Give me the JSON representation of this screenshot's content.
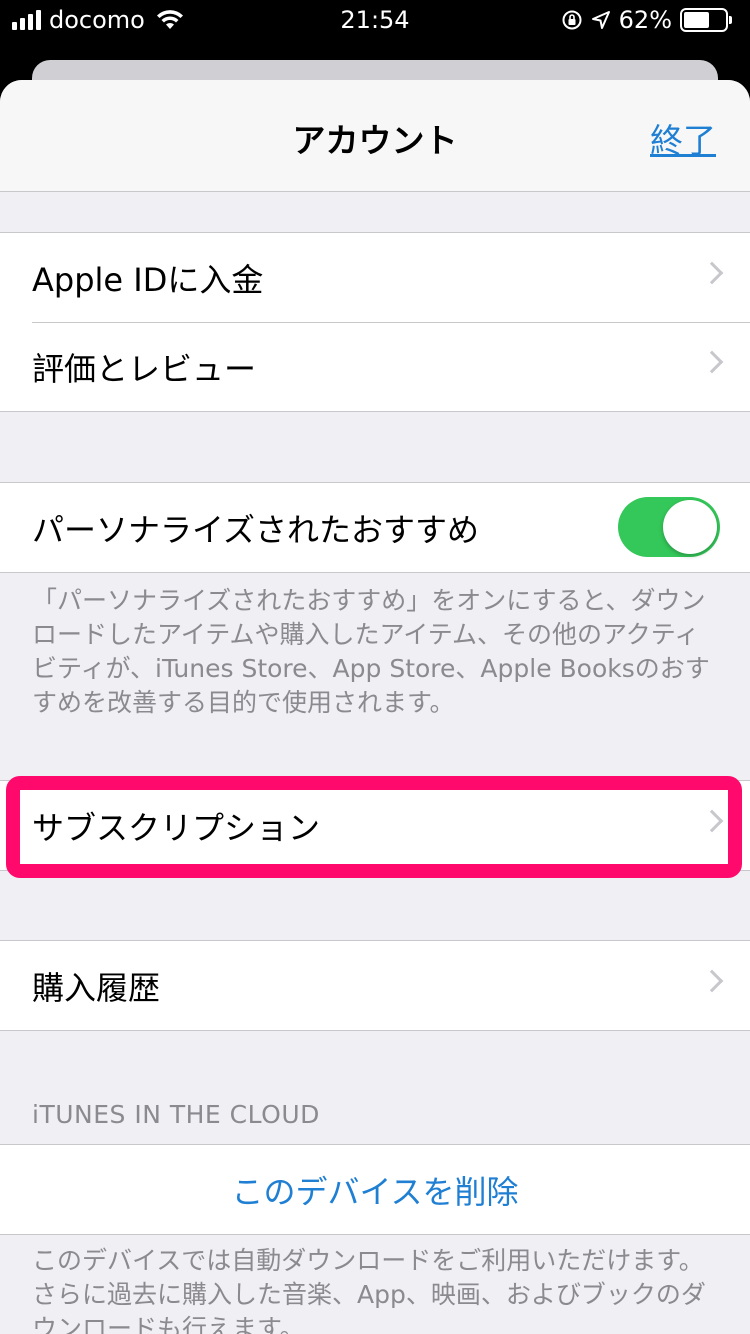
{
  "status_bar": {
    "carrier": "docomo",
    "time": "21:54",
    "battery_percent": "62%",
    "battery_level": 0.62,
    "icons": [
      "signal-icon",
      "wifi-icon",
      "rotation-lock-icon",
      "location-icon",
      "battery-icon"
    ]
  },
  "navbar": {
    "title": "アカウント",
    "done": "終了"
  },
  "group1": {
    "items": [
      {
        "label": "Apple IDに入金"
      },
      {
        "label": "評価とレビュー"
      }
    ]
  },
  "personalized": {
    "label": "パーソナライズされたおすすめ",
    "toggle_on": true,
    "footnote": "「パーソナライズされたおすすめ」をオンにすると、ダウンロードしたアイテムや購入したアイテム、その他のアクティビティが、iTunes Store、App Store、Apple Booksのおすすめを改善する目的で使用されます。"
  },
  "subscriptions": {
    "label": "サブスクリプション"
  },
  "purchase_history": {
    "label": "購入履歴"
  },
  "itunes_cloud": {
    "header": "iTUNES IN THE CLOUD",
    "remove_device": "このデバイスを削除",
    "footnote": "このデバイスでは自動ダウンロードをご利用いただけます。さらに過去に購入した音楽、App、映画、およびブックのダウンロードも行えます。"
  },
  "colors": {
    "accent": "#1f7fd3",
    "toggle_on": "#34c759",
    "highlight": "#ff0a6c",
    "background": "#efeff4"
  }
}
